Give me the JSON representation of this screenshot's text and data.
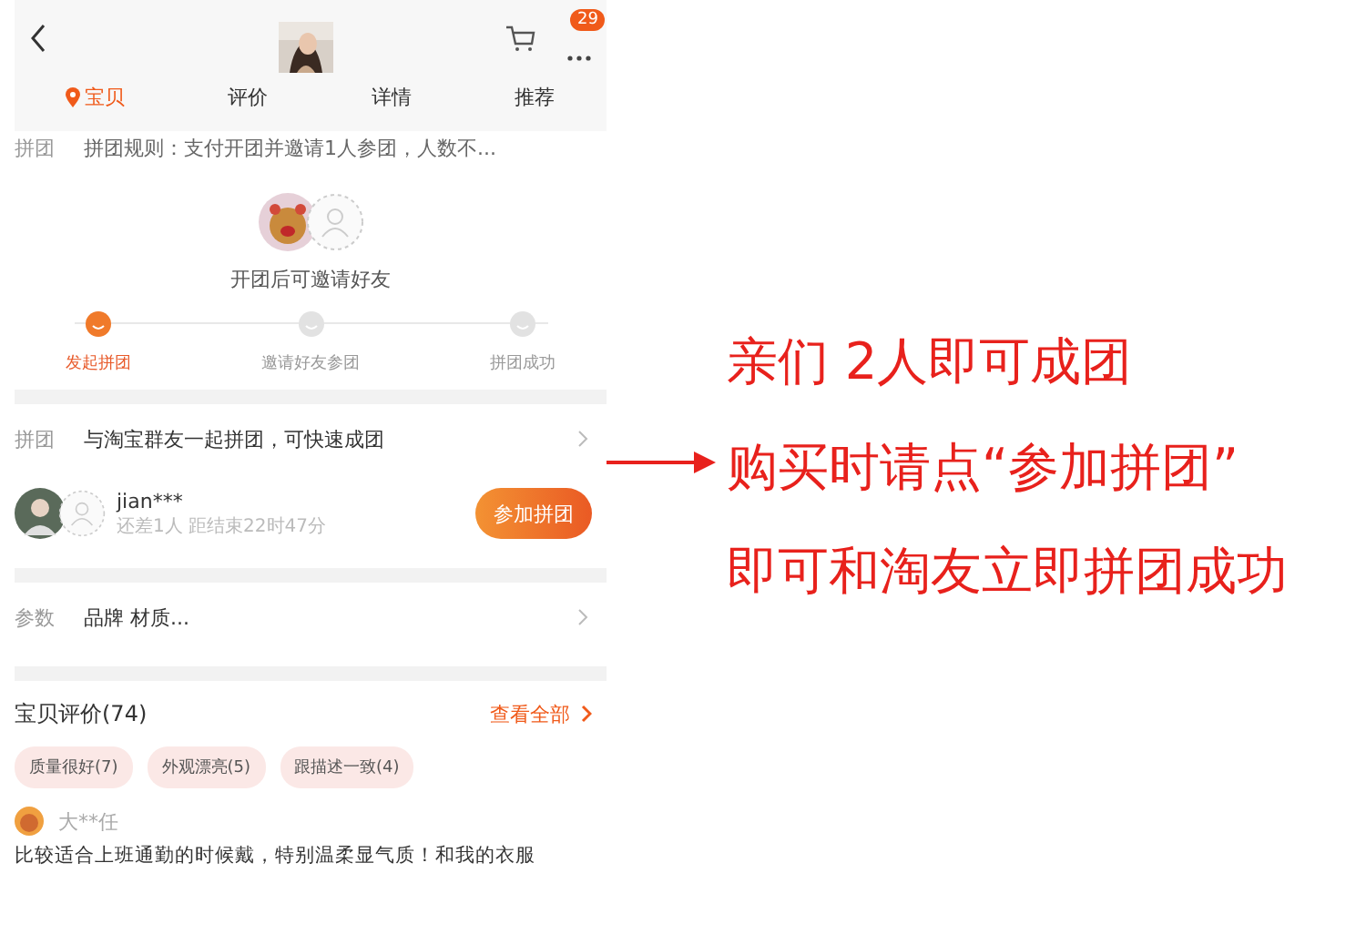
{
  "header": {
    "badge": "29",
    "tabs": [
      {
        "label": "宝贝",
        "selected": true
      },
      {
        "label": "评价",
        "selected": false
      },
      {
        "label": "详情",
        "selected": false
      },
      {
        "label": "推荐",
        "selected": false
      }
    ]
  },
  "rule": {
    "label": "拼团",
    "text": "拼团规则：支付开团并邀请1人参团，人数不..."
  },
  "invite": {
    "caption": "开团后可邀请好友",
    "steps": [
      {
        "label": "发起拼团",
        "active": true
      },
      {
        "label": "邀请好友参团",
        "active": false
      },
      {
        "label": "拼团成功",
        "active": false
      }
    ]
  },
  "group_row": {
    "label": "拼团",
    "text": "与淘宝群友一起拼团，可快速成团"
  },
  "group": {
    "user": "jian***",
    "status": "还差1人 距结束22时47分",
    "button": "参加拼团"
  },
  "params": {
    "label": "参数",
    "text": "品牌 材质..."
  },
  "reviews": {
    "title": "宝贝评价(74)",
    "link": "查看全部",
    "tags": [
      "质量很好(7)",
      "外观漂亮(5)",
      "跟描述一致(4)"
    ],
    "reviewer": "大**任",
    "text": "比较适合上班通勤的时候戴，特别温柔显气质！和我的衣服"
  },
  "annotation": {
    "lines": [
      "亲们 2人即可成团",
      "购买时请点“参加拼团”",
      "即可和淘友立即拼团成功"
    ]
  }
}
